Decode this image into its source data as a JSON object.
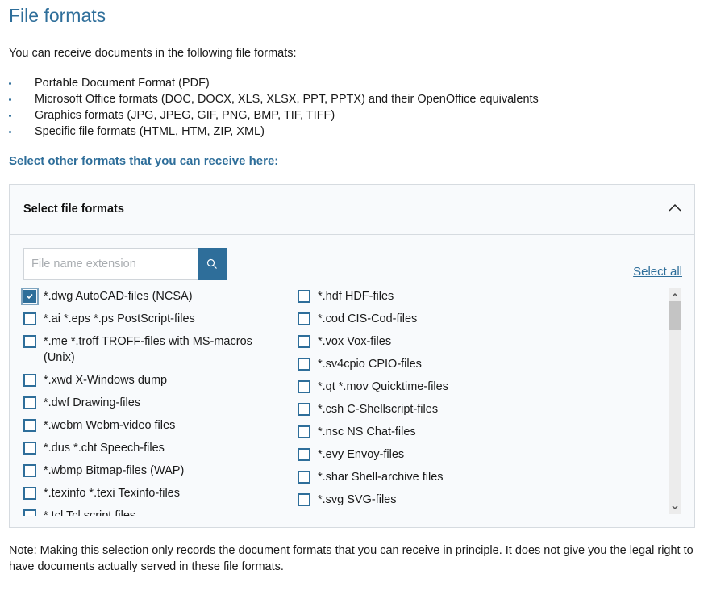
{
  "page": {
    "title": "File formats",
    "intro": "You can receive documents in the following file formats:",
    "default_formats": [
      "Portable Document Format (PDF)",
      "Microsoft Office formats (DOC, DOCX, XLS, XLSX, PPT, PPTX) and their OpenOffice equivalents",
      "Graphics formats (JPG, JPEG, GIF, PNG, BMP, TIF, TIFF)",
      "Specific file formats (HTML, HTM, ZIP, XML)"
    ],
    "subheading": "Select other formats that you can receive here:",
    "note": "Note: Making this selection only records the document formats that you can receive in principle. It does not give you the legal right to have documents actually served in these file formats."
  },
  "panel": {
    "title": "Select file formats",
    "expanded": true,
    "search": {
      "placeholder": "File name extension",
      "value": ""
    },
    "select_all_label": "Select all",
    "left_column": [
      {
        "label": "*.dwg AutoCAD-files (NCSA)",
        "checked": true
      },
      {
        "label": "*.ai *.eps *.ps PostScript-files",
        "checked": false
      },
      {
        "label": "*.me *.troff TROFF-files with MS-macros (Unix)",
        "checked": false
      },
      {
        "label": "*.xwd X-Windows dump",
        "checked": false
      },
      {
        "label": "*.dwf Drawing-files",
        "checked": false
      },
      {
        "label": "*.webm Webm-video files",
        "checked": false
      },
      {
        "label": "*.dus *.cht Speech-files",
        "checked": false
      },
      {
        "label": "*.wbmp Bitmap-files (WAP)",
        "checked": false
      },
      {
        "label": "*.texinfo *.texi Texinfo-files",
        "checked": false
      },
      {
        "label": "*.tcl Tcl script files",
        "checked": false
      }
    ],
    "right_column": [
      {
        "label": "*.hdf HDF-files",
        "checked": false
      },
      {
        "label": "*.cod CIS-Cod-files",
        "checked": false
      },
      {
        "label": "*.vox Vox-files",
        "checked": false
      },
      {
        "label": "*.sv4cpio CPIO-files",
        "checked": false
      },
      {
        "label": "*.qt *.mov Quicktime-files",
        "checked": false
      },
      {
        "label": "*.csh C-Shellscript-files",
        "checked": false
      },
      {
        "label": "*.nsc NS Chat-files",
        "checked": false
      },
      {
        "label": "*.evy Envoy-files",
        "checked": false
      },
      {
        "label": "*.shar Shell-archive files",
        "checked": false
      },
      {
        "label": "*.svg SVG-files",
        "checked": false
      }
    ]
  },
  "colors": {
    "accent": "#2e6e9a",
    "panel_bg": "#f8fafc",
    "border": "#d6dbe0"
  }
}
